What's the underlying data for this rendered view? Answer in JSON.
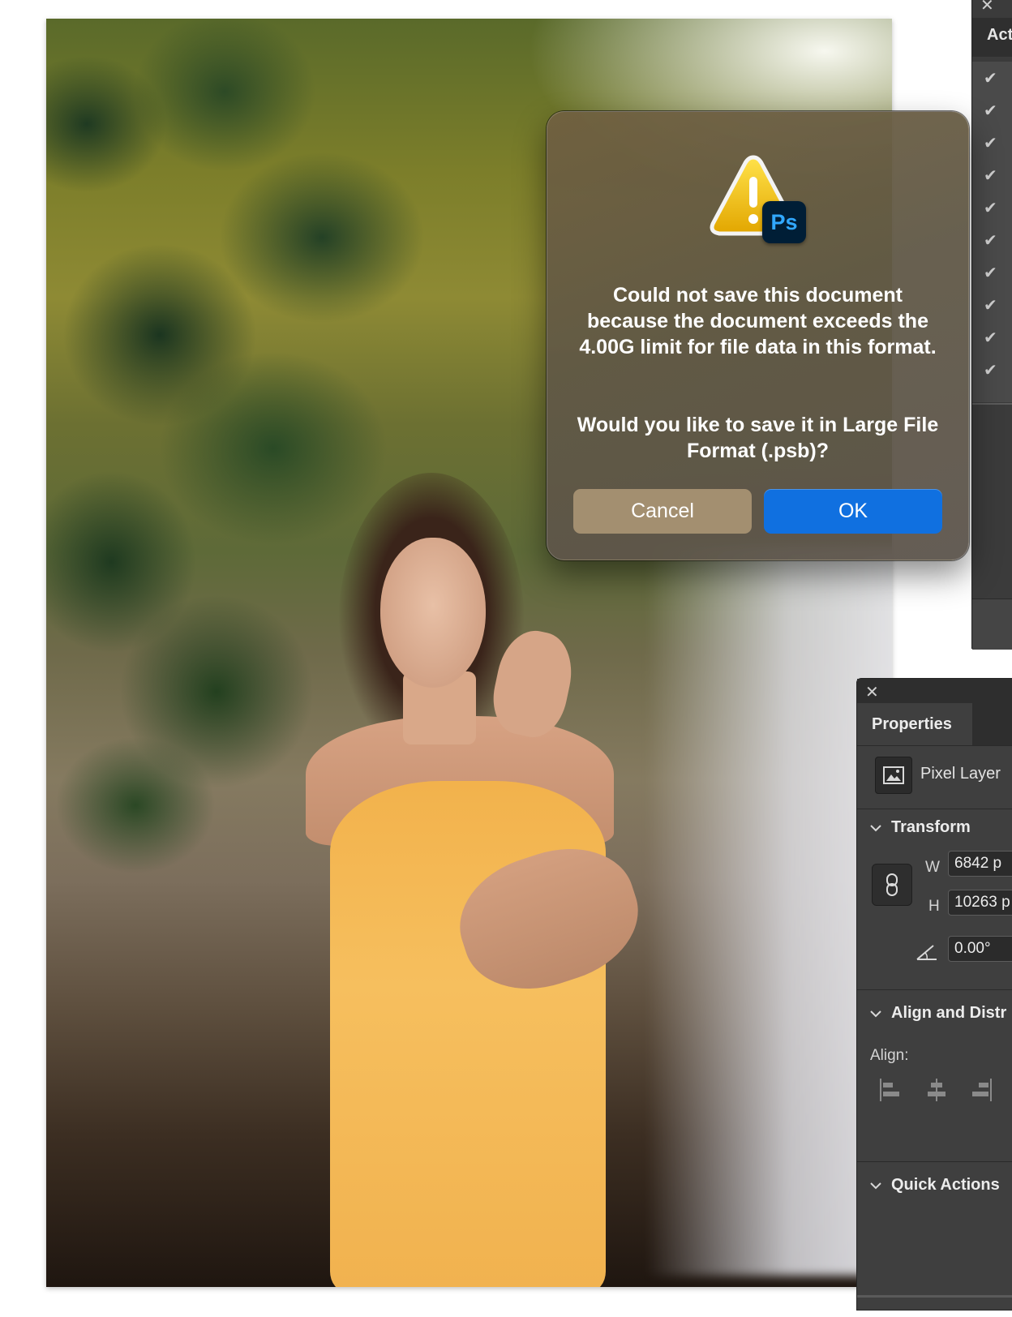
{
  "dialog": {
    "message": "Could not save this document because the document exceeds the 4.00G limit for file data in this format.",
    "question": "Would you like to save it in Large File Format (.psb)?",
    "cancel_label": "Cancel",
    "ok_label": "OK",
    "badge_text": "Ps",
    "icon": "warning-triangle-icon"
  },
  "actions_panel": {
    "title": "Act",
    "close_glyph": "✕",
    "checks": [
      "✔",
      "✔",
      "✔",
      "✔",
      "✔",
      "✔",
      "✔",
      "✔",
      "✔",
      "✔"
    ]
  },
  "properties": {
    "close_glyph": "✕",
    "tab_label": "Properties",
    "layer_type": "Pixel Layer",
    "transform": {
      "label": "Transform",
      "w_label": "W",
      "w_value": "6842 p",
      "h_label": "H",
      "h_value": "10263 p",
      "angle_value": "0.00°"
    },
    "align_section": {
      "label": "Align and Distr",
      "align_label": "Align:"
    },
    "quick_actions_label": "Quick Actions"
  },
  "colors": {
    "ok_button": "#1070e0",
    "cancel_button": "#a38f70",
    "panel_bg": "#3f3f3f"
  }
}
